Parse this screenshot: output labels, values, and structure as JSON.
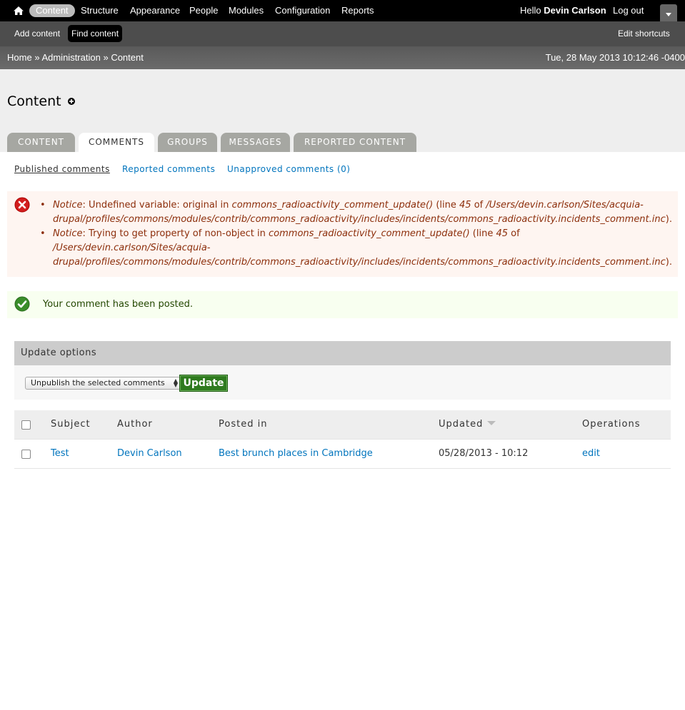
{
  "toolbar": {
    "items": [
      {
        "label": "Content"
      },
      {
        "label": "Structure"
      },
      {
        "label": "Appearance"
      },
      {
        "label": "People"
      },
      {
        "label": "Modules"
      },
      {
        "label": "Configuration"
      },
      {
        "label": "Reports"
      }
    ],
    "hello": "Hello",
    "username": "Devin Carlson",
    "logout": "Log out"
  },
  "shortcuts": {
    "add_content": "Add content",
    "find_content": "Find content",
    "edit_shortcuts": "Edit shortcuts"
  },
  "breadcrumb": {
    "items": [
      "Home",
      "Administration",
      "Content"
    ],
    "separator": "»",
    "timestamp": "Tue, 28 May 2013 10:12:46 -0400"
  },
  "page": {
    "title": "Content",
    "tabs": [
      {
        "label": "CONTENT"
      },
      {
        "label": "COMMENTS"
      },
      {
        "label": "GROUPS"
      },
      {
        "label": "MESSAGES"
      },
      {
        "label": "REPORTED CONTENT"
      }
    ],
    "subtabs": [
      {
        "label": "Published comments"
      },
      {
        "label": "Reported comments"
      },
      {
        "label": "Unapproved comments (0)"
      }
    ]
  },
  "errors": [
    {
      "type": "Notice",
      "pre": ": Undefined variable: original in ",
      "func": "commons_radioactivity_comment_update()",
      "mid": " (line ",
      "line": "45",
      "of": " of ",
      "file": "/Users/devin.carlson/Sites/acquia-drupal/profiles/commons/modules/contrib/commons_radioactivity/includes/incidents/commons_radioactivity.incidents_comment.inc",
      "end": ")."
    },
    {
      "type": "Notice",
      "pre": ": Trying to get property of non-object in ",
      "func": "commons_radioactivity_comment_update()",
      "mid": " (line ",
      "line": "45",
      "of": " of ",
      "file": "/Users/devin.carlson/Sites/acquia-drupal/profiles/commons/modules/contrib/commons_radioactivity/includes/incidents/commons_radioactivity.incidents_comment.inc",
      "end": ")."
    }
  ],
  "status": {
    "message": "Your comment has been posted."
  },
  "update_options": {
    "legend": "Update options",
    "selected": "Unpublish the selected comments",
    "button": "Update"
  },
  "table": {
    "headers": [
      "Subject",
      "Author",
      "Posted in",
      "Updated",
      "Operations"
    ],
    "rows": [
      {
        "subject": "Test",
        "author": "Devin Carlson",
        "posted_in": "Best brunch places in Cambridge",
        "updated": "05/28/2013 - 10:12",
        "operation": "edit"
      }
    ]
  },
  "colors": {
    "toolbar_bg": "#000000",
    "shortcuts_bg": "#4d4d4d",
    "link": "#0074bd",
    "error_bg": "#fef5f1",
    "error_text": "#8c2e0b",
    "status_bg": "#f8fff0",
    "update_button": "#2e7a1e"
  }
}
